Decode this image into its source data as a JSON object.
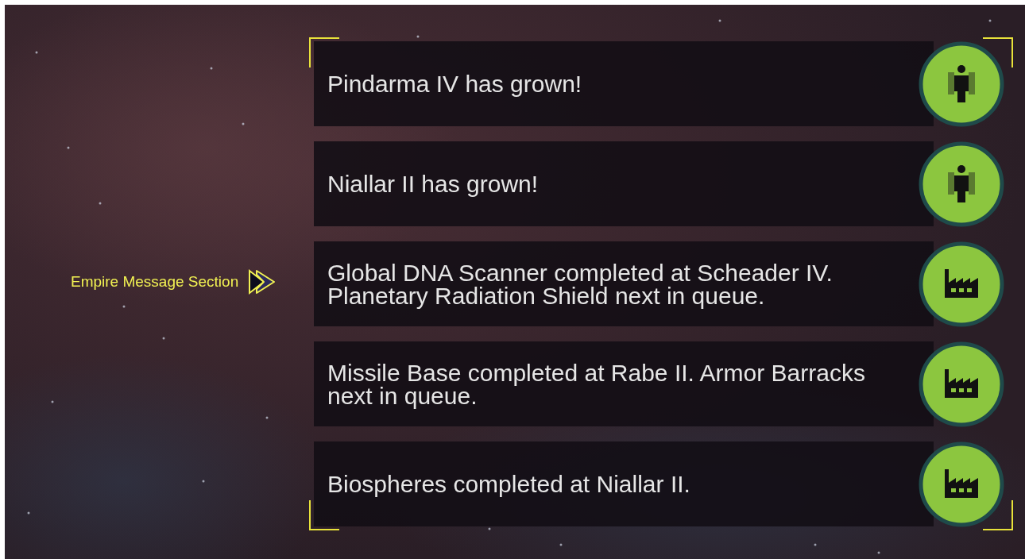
{
  "annotation": {
    "label": "Empire Message Section"
  },
  "messages": [
    {
      "text": "Pindarma IV has grown!",
      "kind": "population"
    },
    {
      "text": "Niallar II has grown!",
      "kind": "population"
    },
    {
      "text": "Global DNA Scanner completed at Scheader IV. Planetary Radiation Shield next in queue.",
      "kind": "production"
    },
    {
      "text": "Missile Base completed at Rabe II. Armor Barracks next in queue.",
      "kind": "production"
    },
    {
      "text": "Biospheres completed at Niallar II.",
      "kind": "production"
    }
  ]
}
